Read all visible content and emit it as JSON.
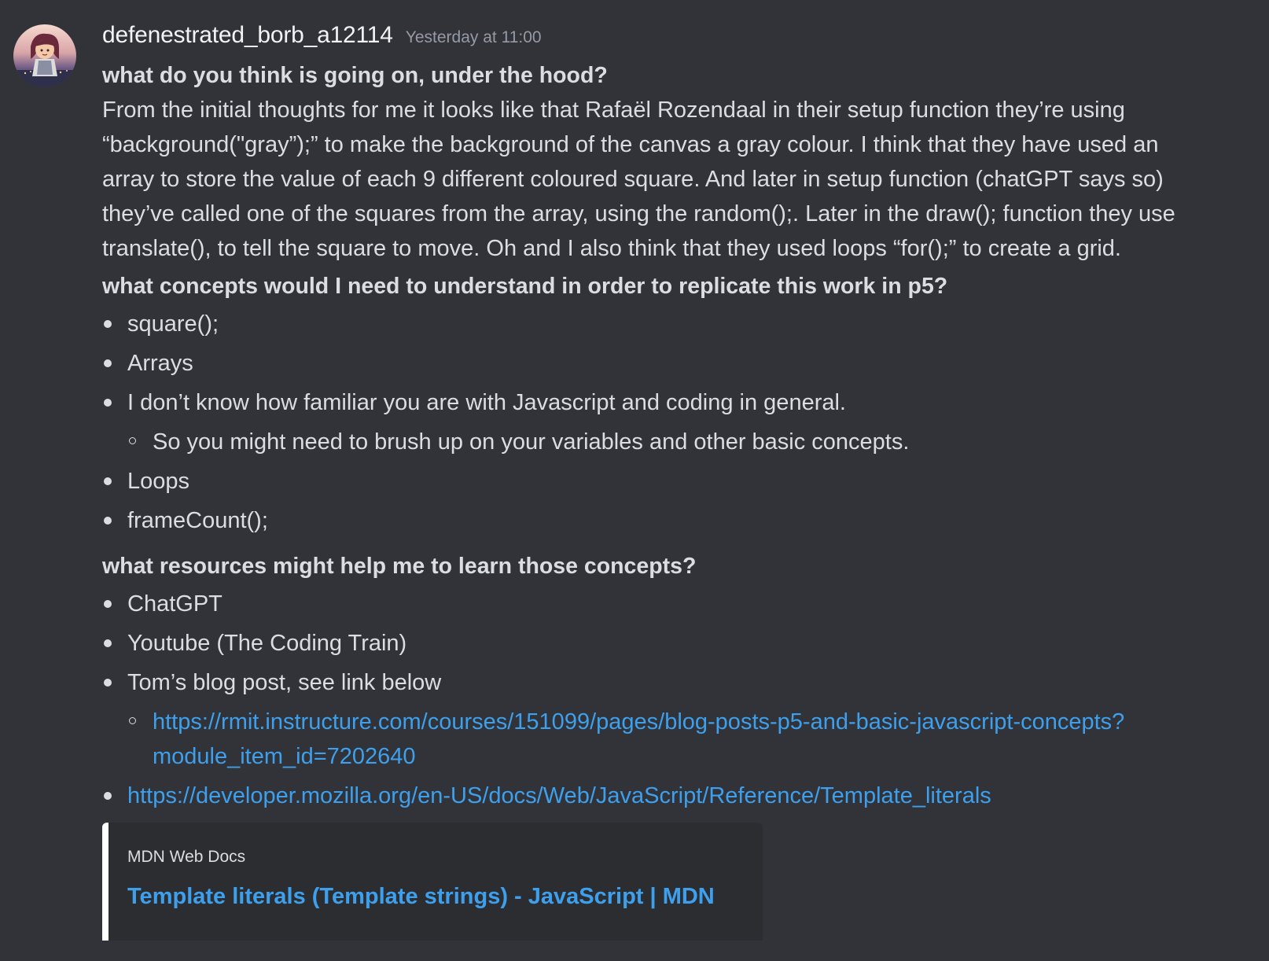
{
  "message": {
    "username": "defenestrated_borb_a12114",
    "timestamp": "Yesterday at 11:00",
    "q1": "what do you think is going on, under the hood?",
    "paragraph_lines": [
      "From the initial thoughts for me it looks like that Rafaël Rozendaal in their setup function they’re using",
      "“background(\"gray”);” to make the background of the canvas a gray colour. I think that they have used an",
      "array to store the value of each 9 different coloured square. And later in setup function (chatGPT says so)",
      "they’ve called one of the squares from the array, using the random();. Later in the draw(); function they use",
      "translate(), to tell the square to move. Oh and I also think that they used loops “for();” to create a grid."
    ],
    "q2": "what concepts would I need to understand in order to replicate this work in p5?",
    "concepts": {
      "item1": "square();",
      "item2": "Arrays",
      "item3": "I don’t know how familiar you are with Javascript and coding in general.",
      "item3_sub": "So you might need to brush up on your variables and other basic concepts.",
      "item4": "Loops",
      "item5": "frameCount();"
    },
    "q3": "what resources might help me to learn those concepts?",
    "resources": {
      "item1": "ChatGPT",
      "item2": "Youtube (The Coding Train)",
      "item3": "Tom’s blog post, see link below",
      "item3_link_line1": "https://rmit.instructure.com/courses/151099/pages/blog-posts-p5-and-basic-javascript-concepts?",
      "item3_link_line2": "module_item_id=7202640",
      "item4_link": "https://developer.mozilla.org/en-US/docs/Web/JavaScript/Reference/Template_literals"
    },
    "embed": {
      "provider": "MDN Web Docs",
      "title": "Template literals (Template strings) - JavaScript | MDN"
    }
  },
  "colors": {
    "background": "#313338",
    "text": "#dbdee1",
    "username": "#f2f3f5",
    "timestamp": "#949ba4",
    "link": "#3ea0ec",
    "embed_background": "#2b2d31",
    "embed_border": "#ffffff"
  }
}
